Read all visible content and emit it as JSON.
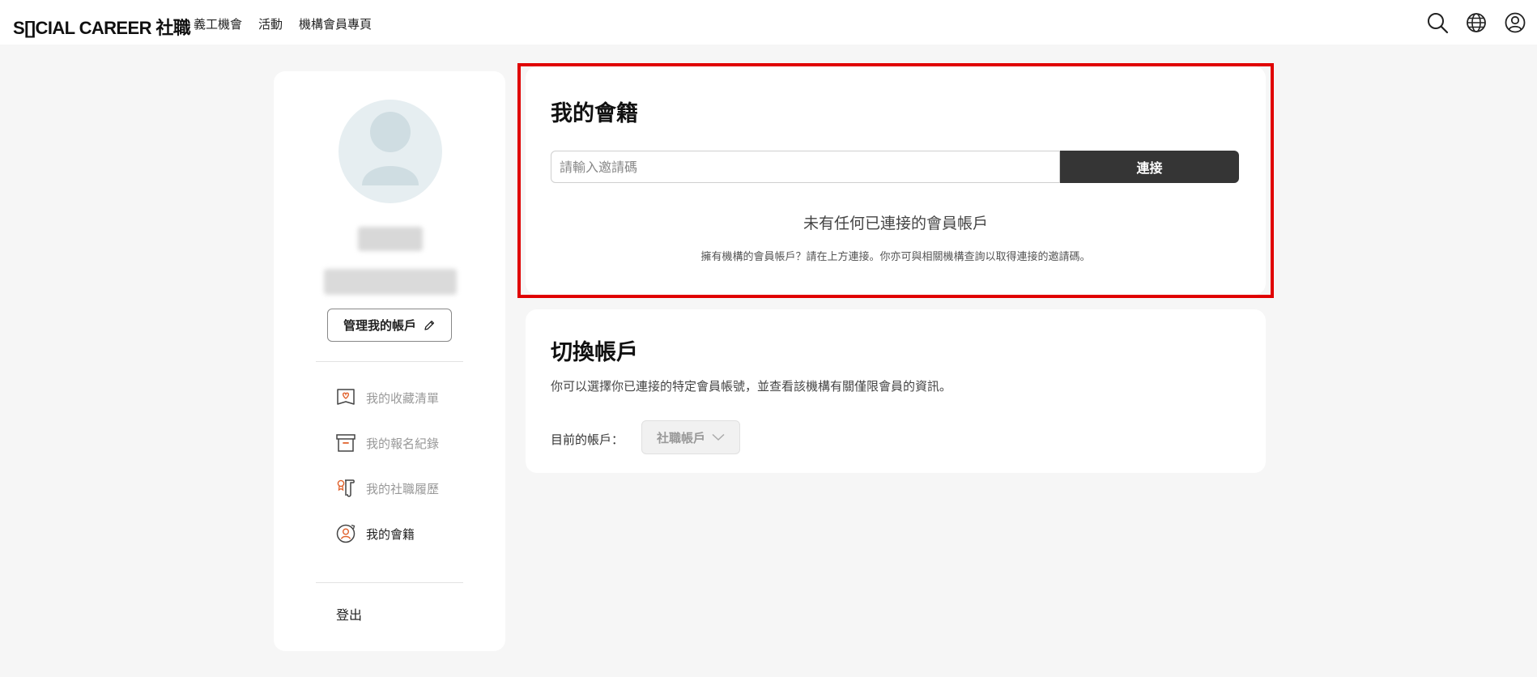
{
  "header": {
    "logo": "S[]CIAL CAREER 社職",
    "nav": [
      "義工機會",
      "活動",
      "機構會員專頁"
    ]
  },
  "sidebar": {
    "manage_label": "管理我的帳戶",
    "menu": [
      {
        "label": "我的收藏清單",
        "icon": "bookmark-heart-icon"
      },
      {
        "label": "我的報名紀錄",
        "icon": "archive-box-icon"
      },
      {
        "label": "我的社職履歷",
        "icon": "scroll-ribbon-icon"
      },
      {
        "label": "我的會籍",
        "icon": "member-badge-icon",
        "active": true
      }
    ],
    "logout_label": "登出"
  },
  "membership": {
    "title": "我的會籍",
    "input_placeholder": "請輸入邀請碼",
    "input_value": "",
    "connect_label": "連接",
    "empty_title": "未有任何已連接的會員帳戶",
    "empty_desc": "擁有機構的會員帳戶？請在上方連接。你亦可與相關機構查詢以取得連接的邀請碼。"
  },
  "switch_account": {
    "title": "切換帳戶",
    "desc": "你可以選擇你已連接的特定會員帳號，並查看該機構有關僅限會員的資訊。",
    "current_label": "目前的帳戶：",
    "selected": "社職帳戶"
  },
  "colors": {
    "accent_button": "#353535",
    "highlight_border": "#e00000",
    "background": "#f6f6f6",
    "avatar_bg": "#e6eef1",
    "icon_orange": "#e0602a"
  }
}
